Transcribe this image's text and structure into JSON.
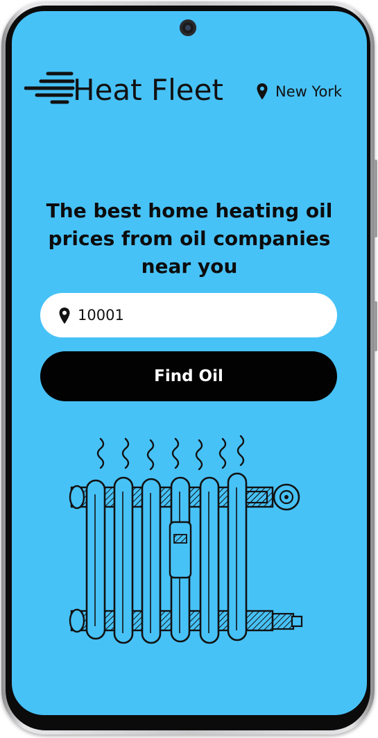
{
  "app": {
    "brand_name": "Heat Fleet",
    "brand_icon": "speed-lines-icon",
    "location": {
      "icon": "map-pin-icon",
      "label": "New York"
    }
  },
  "hero": {
    "headline": "The best home heating oil prices from oil companies near you"
  },
  "search": {
    "icon": "map-pin-icon",
    "zip_value": "10001",
    "zip_placeholder": "10001",
    "button_label": "Find Oil"
  },
  "illustration": {
    "name": "radiator-illustration"
  },
  "colors": {
    "screen_background": "#47c2f7",
    "button_background": "#020202",
    "button_text": "#ffffff",
    "input_background": "#ffffff",
    "text_primary": "#111111"
  }
}
